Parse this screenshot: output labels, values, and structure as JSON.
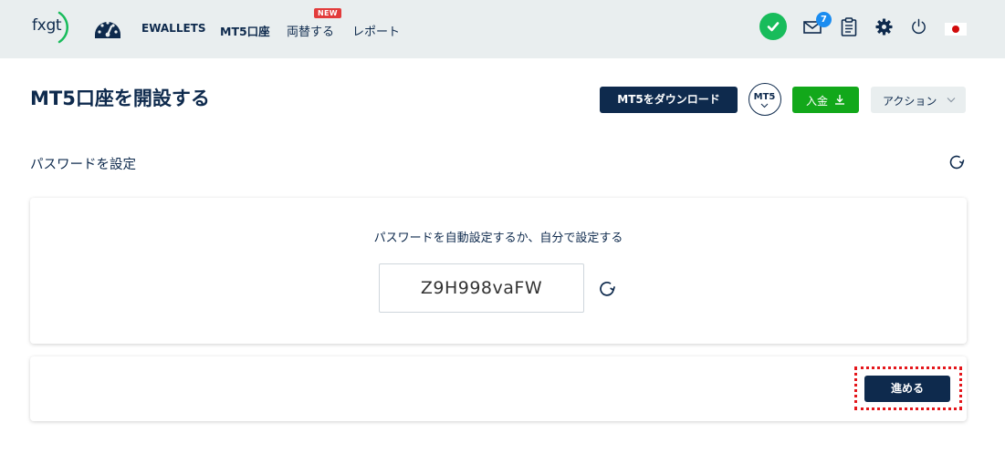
{
  "nav": {
    "logo_text": "fxgt",
    "items": [
      {
        "label": "EWALLETS"
      },
      {
        "label": "MT5口座"
      },
      {
        "label": "両替する"
      },
      {
        "label": "レポート"
      }
    ],
    "new_badge": "NEW",
    "mail_count": "7"
  },
  "header": {
    "title": "MT5口座を開設する",
    "download_label": "MT5をダウンロード",
    "mt5_label": "MT5",
    "deposit_label": "入金",
    "action_label": "アクション"
  },
  "section": {
    "title": "パスワードを設定"
  },
  "password_card": {
    "instruction": "パスワードを自動設定するか、自分で設定する",
    "password_value": "Z9H998vaFW"
  },
  "footer": {
    "proceed_label": "進める"
  },
  "colors": {
    "navy": "#0e2a4d",
    "topbar_bg": "#e9eeef",
    "green": "#12a81a",
    "verified": "#18bc5b",
    "badge_red": "#e23b3b",
    "badge_blue": "#1a8cf0",
    "highlight": "#e4161b"
  }
}
